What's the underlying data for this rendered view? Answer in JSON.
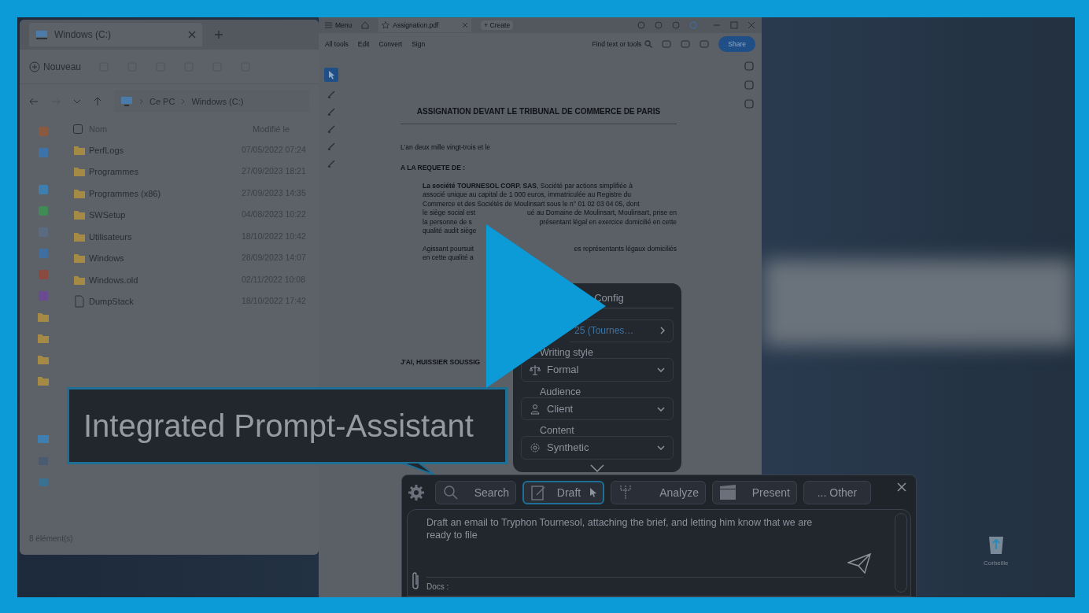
{
  "explorer": {
    "tab_title": "Windows (C:)",
    "new_button": "Nouveau",
    "breadcrumb": [
      "Ce PC",
      "Windows (C:)"
    ],
    "columns": [
      "Nom",
      "Modifié le"
    ],
    "rows": [
      {
        "name": "PerfLogs",
        "modified": "07/05/2022 07:24",
        "kind": "folder"
      },
      {
        "name": "Programmes",
        "modified": "27/09/2023 18:21",
        "kind": "folder"
      },
      {
        "name": "Programmes (x86)",
        "modified": "27/09/2023 14:35",
        "kind": "folder"
      },
      {
        "name": "SWSetup",
        "modified": "04/08/2023 10:22",
        "kind": "folder"
      },
      {
        "name": "Utilisateurs",
        "modified": "18/10/2022 10:42",
        "kind": "folder"
      },
      {
        "name": "Windows",
        "modified": "28/09/2023 14:07",
        "kind": "folder"
      },
      {
        "name": "Windows.old",
        "modified": "02/11/2022 10:08",
        "kind": "folder"
      },
      {
        "name": "DumpStack",
        "modified": "18/10/2022 17:42",
        "kind": "file"
      }
    ],
    "status": "8 élément(s)"
  },
  "pdf": {
    "menu": "Menu",
    "tab": "Assignation.pdf",
    "create": "+ Create",
    "tools": [
      "All tools",
      "Edit",
      "Convert",
      "Sign"
    ],
    "search_placeholder": "Find text or tools",
    "share": "Share",
    "document": {
      "title": "ASSIGNATION DEVANT LE TRIBUNAL DE COMMERCE DE PARIS",
      "intro": "L'an deux mille vingt-trois et le",
      "requester": "A LA REQUETE DE :",
      "paragraphs": [
        [
          {
            "left": "**La société TOURNESOL CORP. SAS**, Société par actions simplifiée à"
          },
          {
            "left": "associé unique au capital de 1 000 euros, immatriculée au Registre du"
          },
          {
            "left": "Commerce et des Sociétés de Moulinsart sous le n° 01 02 03 04 05, dont"
          },
          {
            "left": "le siège social est",
            "right": "ué au Domaine de Moulinsart, Moulinsart, prise en"
          },
          {
            "left": "la personne de s",
            "right": "présentant légal en exercice domicilié en cette"
          },
          {
            "left": "qualité audit siège"
          }
        ],
        [
          {
            "left": "Agissant poursuit",
            "right": "es représentants légaux domiciliés"
          },
          {
            "left": "en cette qualité a"
          }
        ]
      ],
      "section": "J'AI, HUISSIER SOUSSIG"
    }
  },
  "config_panel": {
    "title": "Config",
    "case": "25 (Tournes…",
    "fields": [
      {
        "label": "Writing style",
        "value": "Formal"
      },
      {
        "label": "Audience",
        "value": "Client"
      },
      {
        "label": "Content",
        "value": "Synthetic"
      }
    ]
  },
  "callout": {
    "text": "Integrated Prompt-Assistant"
  },
  "assistant": {
    "modes": [
      {
        "label": "Search",
        "selected": false
      },
      {
        "label": "Draft",
        "selected": true
      },
      {
        "label": "Analyze",
        "selected": false
      },
      {
        "label": "Present",
        "selected": false
      },
      {
        "label": "... Other",
        "selected": false
      }
    ],
    "prompt": "Draft an email  to Tryphon Tournesol, attaching the brief, and letting him know that we are ready to file",
    "docs_label": "Docs :"
  },
  "desktop": {
    "recycle_bin": "Corbeille"
  }
}
